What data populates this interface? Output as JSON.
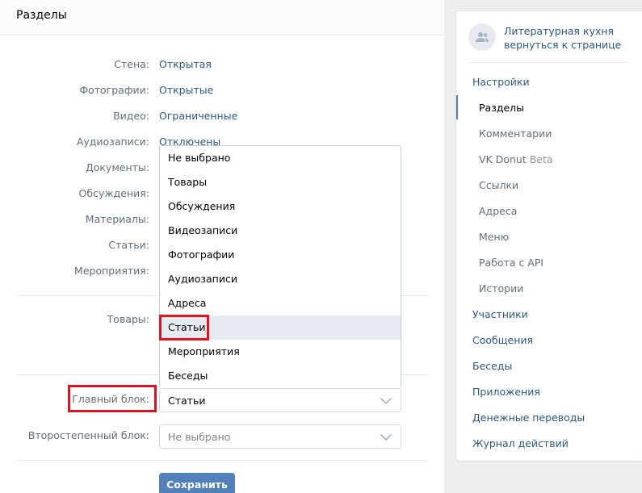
{
  "main": {
    "title": "Разделы",
    "rows": [
      {
        "label": "Стена:",
        "value": "Открытая"
      },
      {
        "label": "Фотографии:",
        "value": "Открытые"
      },
      {
        "label": "Видео:",
        "value": "Ограниченные"
      },
      {
        "label": "Аудиозаписи:",
        "value": "Отключены"
      },
      {
        "label": "Документы:",
        "value": ""
      },
      {
        "label": "Обсуждения:",
        "value": ""
      },
      {
        "label": "Материалы:",
        "value": ""
      },
      {
        "label": "Статьи:",
        "value": ""
      },
      {
        "label": "Мероприятия:",
        "value": ""
      }
    ],
    "goods_label": "Товары:",
    "main_block_label": "Главный блок:",
    "main_block_value": "Статьи",
    "secondary_block_label": "Второстепенный блок:",
    "secondary_block_value": "Не выбрано",
    "save_label": "Сохранить"
  },
  "dropdown": {
    "options": [
      "Не выбрано",
      "Товары",
      "Обсуждения",
      "Видеозаписи",
      "Фотографии",
      "Аудиозаписи",
      "Адреса",
      "Статьи",
      "Мероприятия",
      "Беседы"
    ],
    "highlighted": "Статьи"
  },
  "sidebar": {
    "group_name": "Литературная кухня",
    "back_link": "вернуться к странице",
    "menu": [
      {
        "label": "Настройки"
      },
      {
        "label": "Разделы"
      },
      {
        "label": "Комментарии"
      },
      {
        "label": "VK Donut",
        "badge": "Beta"
      },
      {
        "label": "Ссылки"
      },
      {
        "label": "Адреса"
      },
      {
        "label": "Меню"
      },
      {
        "label": "Работа с API"
      },
      {
        "label": "Истории"
      },
      {
        "label": "Участники"
      },
      {
        "label": "Сообщения"
      },
      {
        "label": "Беседы"
      },
      {
        "label": "Приложения"
      },
      {
        "label": "Денежные переводы"
      },
      {
        "label": "Журнал действий"
      }
    ]
  },
  "colors": {
    "accent": "#5181b8",
    "link": "#2a5885",
    "highlight_frame": "#e01421"
  }
}
